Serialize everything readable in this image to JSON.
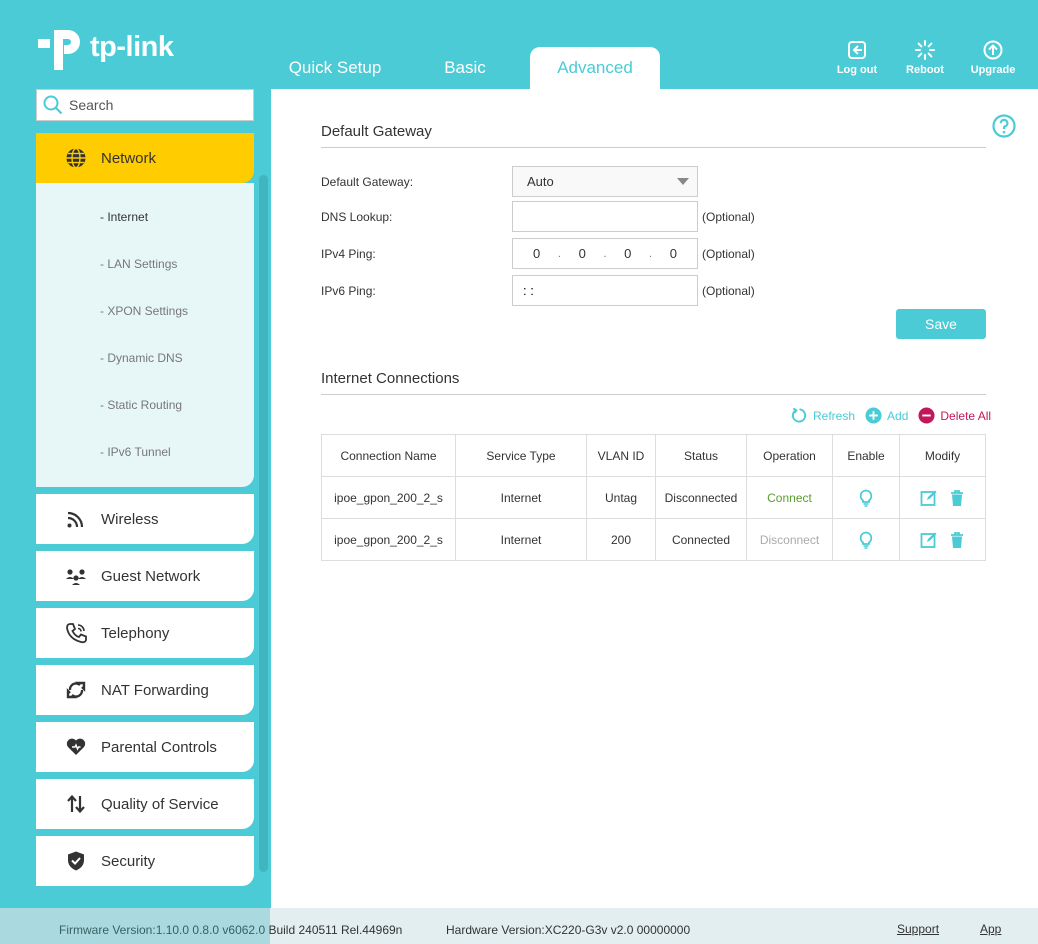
{
  "brand": {
    "logo_text": "tp-link"
  },
  "nav": {
    "tabs": [
      {
        "label": "Quick Setup"
      },
      {
        "label": "Basic"
      },
      {
        "label": "Advanced"
      }
    ]
  },
  "header_actions": {
    "logout": "Log out",
    "reboot": "Reboot",
    "upgrade": "Upgrade"
  },
  "search": {
    "placeholder": "Search"
  },
  "sidebar": {
    "active": "Network",
    "network_sub": [
      "- Internet",
      "- LAN Settings",
      "- XPON Settings",
      "- Dynamic DNS",
      "- Static Routing",
      "- IPv6 Tunnel"
    ],
    "items": [
      "Wireless",
      "Guest Network",
      "Telephony",
      "NAT Forwarding",
      "Parental Controls",
      "Quality of Service",
      "Security"
    ]
  },
  "gateway": {
    "title": "Default Gateway",
    "label_gateway": "Default Gateway:",
    "gateway_value": "Auto",
    "label_dns": "DNS Lookup:",
    "dns_value": "",
    "label_ipv4": "IPv4 Ping:",
    "ipv4_octets": [
      "0",
      "0",
      "0",
      "0"
    ],
    "label_ipv6": "IPv6 Ping:",
    "ipv6_value": ": :",
    "optional": "(Optional)",
    "save": "Save"
  },
  "connections": {
    "title": "Internet Connections",
    "refresh": "Refresh",
    "add": "Add",
    "delete_all": "Delete All",
    "headers": [
      "Connection Name",
      "Service Type",
      "VLAN ID",
      "Status",
      "Operation",
      "Enable",
      "Modify"
    ],
    "rows": [
      {
        "name": "ipoe_gpon_200_2_s",
        "service": "Internet",
        "vlan": "Untag",
        "status": "Disconnected",
        "operation": "Connect"
      },
      {
        "name": "ipoe_gpon_200_2_s",
        "service": "Internet",
        "vlan": "200",
        "status": "Connected",
        "operation": "Disconnect"
      }
    ]
  },
  "footer": {
    "firmware": "Firmware Version:1.10.0 0.8.0 v6062.0 Build 240511 Rel.44969n",
    "hardware": "Hardware Version:XC220-G3v v2.0 00000000",
    "support": "Support",
    "app": "App"
  },
  "colors": {
    "accent": "#4acbd6",
    "active_menu": "#ffcc00",
    "connect": "#5a9e2d",
    "delete": "#c2185b"
  }
}
